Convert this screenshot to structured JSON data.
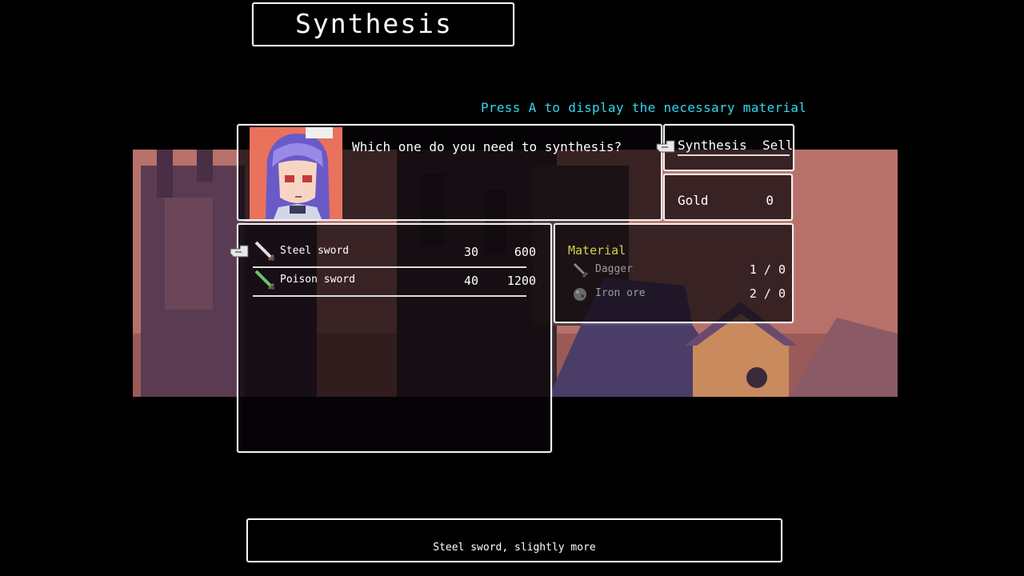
{
  "screen_title": "Synthesis",
  "hint": "Press A to display the necessary material",
  "dialog": {
    "question": "Which one do you need to synthesis?"
  },
  "commands": {
    "synthesis": "Synthesis",
    "sell": "Sell",
    "selected": "synthesis"
  },
  "gold": {
    "label": "Gold",
    "value": "0"
  },
  "items": [
    {
      "name": "Steel sword",
      "required": "30",
      "price": "600",
      "icon": "steel-sword-icon"
    },
    {
      "name": "Poison sword",
      "required": "40",
      "price": "1200",
      "icon": "poison-sword-icon"
    }
  ],
  "materials": {
    "title": "Material",
    "rows": [
      {
        "name": "Dagger",
        "count": "1 / 0",
        "icon": "dagger-icon"
      },
      {
        "name": "Iron ore",
        "count": "2 / 0",
        "icon": "iron-ore-icon"
      }
    ]
  },
  "description": "Steel sword, slightly more",
  "colors": {
    "hint": "#33d6ee",
    "material_title": "#d8d24a",
    "panel_border": "#f2f2f2"
  }
}
